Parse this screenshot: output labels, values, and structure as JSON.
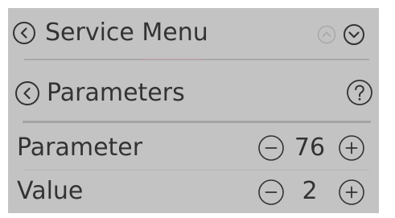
{
  "service_menu": {
    "title": "Service Menu",
    "back_icon": "chevron-left-circle-icon",
    "up_icon": "chevron-up-circle-icon",
    "down_icon": "chevron-down-circle-icon"
  },
  "parameters": {
    "title": "Parameters",
    "back_icon": "chevron-left-circle-icon",
    "help_icon": "question-circle-icon"
  },
  "rows": [
    {
      "label": "Parameter",
      "value": "76"
    },
    {
      "label": "Value",
      "value": "2"
    }
  ],
  "colors": {
    "panel_background": "#c3c3c4",
    "text": "#333333",
    "disabled_icon": "#a9a9ab",
    "divider": "#a9a9ab",
    "accent_line": "#d49a9a"
  }
}
